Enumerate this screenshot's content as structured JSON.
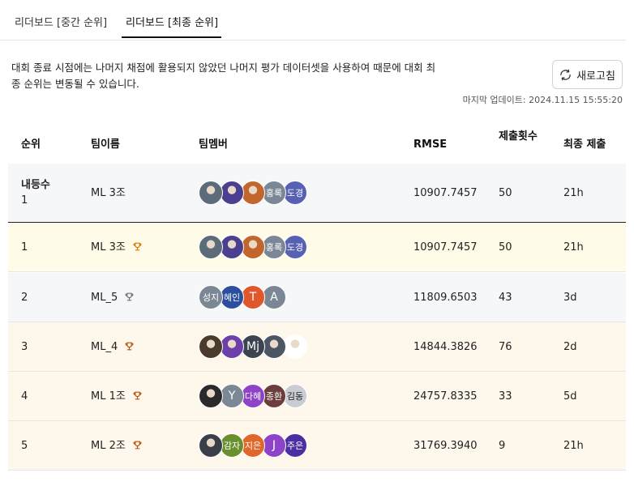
{
  "tabs": [
    "리더보드 [중간 순위]",
    "리더보드 [최종 순위]"
  ],
  "description": "대회 종료 시점에는 나머지 채점에 활용되지 않았던 나머지 평가 데이터셋을 사용하여 때문에 대회 최종 순위는 변동될 수 있습니다.",
  "refresh_label": "새로고침",
  "last_updated": "마지막 업데이트: 2024.11.15 15:55:20",
  "columns": {
    "rank": "순위",
    "team": "팀이름",
    "members": "팀멤버",
    "rmse": "RMSE",
    "submissions": "제출횟수",
    "last": "최종 제출"
  },
  "colors": {
    "trophy_gold": "#d97706",
    "trophy_silver": "#6b7280",
    "trophy_bronze": "#b45309"
  },
  "my_row": {
    "rank_label": "내등수",
    "rank": "1",
    "team": "ML 3조",
    "members": [
      {
        "type": "photo",
        "color": "#5b6b7a"
      },
      {
        "type": "photo",
        "color": "#4b3f8f"
      },
      {
        "type": "photo",
        "color": "#c2662d"
      },
      {
        "type": "text",
        "label": "홍록",
        "color": "#7b8794"
      },
      {
        "type": "text",
        "label": "도경",
        "color": "#5661b3"
      }
    ],
    "rmse": "10907.7457",
    "submissions": "50",
    "last": "21h"
  },
  "rows": [
    {
      "rank": "1",
      "team": "ML 3조",
      "trophy": "gold",
      "members": [
        {
          "type": "photo",
          "color": "#5b6b7a"
        },
        {
          "type": "photo",
          "color": "#4b3f8f"
        },
        {
          "type": "photo",
          "color": "#c2662d"
        },
        {
          "type": "text",
          "label": "홍록",
          "color": "#7b8794"
        },
        {
          "type": "text",
          "label": "도경",
          "color": "#5661b3"
        }
      ],
      "rmse": "10907.7457",
      "submissions": "50",
      "last": "21h"
    },
    {
      "rank": "2",
      "team": "ML_5",
      "trophy": "silver",
      "members": [
        {
          "type": "text",
          "label": "성지",
          "color": "#7b8794"
        },
        {
          "type": "text",
          "label": "혜인",
          "color": "#2b4f9e"
        },
        {
          "type": "letter",
          "label": "T",
          "color": "#e0572c"
        },
        {
          "type": "letter",
          "label": "A",
          "color": "#7b8794"
        }
      ],
      "rmse": "11809.6503",
      "submissions": "43",
      "last": "3d"
    },
    {
      "rank": "3",
      "team": "ML_4",
      "trophy": "bronze",
      "members": [
        {
          "type": "photo",
          "color": "#4a3b2a"
        },
        {
          "type": "photo",
          "color": "#6d3fa8"
        },
        {
          "type": "letter",
          "label": "Mj",
          "color": "#3d4451"
        },
        {
          "type": "photo",
          "color": "#4b5563"
        },
        {
          "type": "photo",
          "color": "#ffffff"
        }
      ],
      "rmse": "14844.3826",
      "submissions": "76",
      "last": "2d"
    },
    {
      "rank": "4",
      "team": "ML 1조",
      "trophy": "bronze",
      "members": [
        {
          "type": "photo",
          "color": "#2a2a2a"
        },
        {
          "type": "letter",
          "label": "Y",
          "color": "#7b8794"
        },
        {
          "type": "text",
          "label": "다혜",
          "color": "#8e44c9"
        },
        {
          "type": "text",
          "label": "종환",
          "color": "#6b3d3d"
        },
        {
          "type": "text",
          "label": "김동",
          "color": "#c9ccd3",
          "dark": true
        }
      ],
      "rmse": "24757.8335",
      "submissions": "33",
      "last": "5d"
    },
    {
      "rank": "5",
      "team": "ML 2조",
      "trophy": "bronze",
      "members": [
        {
          "type": "photo",
          "color": "#3a3f4a"
        },
        {
          "type": "text",
          "label": "감자",
          "color": "#6a8f2e"
        },
        {
          "type": "text",
          "label": "지은",
          "color": "#e0662c"
        },
        {
          "type": "letter",
          "label": "J",
          "color": "#8e44c9"
        },
        {
          "type": "text",
          "label": "주은",
          "color": "#4b2fa0"
        }
      ],
      "rmse": "31769.3940",
      "submissions": "9",
      "last": "21h"
    }
  ]
}
